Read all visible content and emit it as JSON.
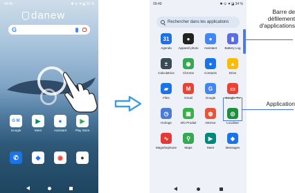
{
  "left_phone": {
    "time": "09:46",
    "status_icons": "✱ ⊙ ▼◪ 35 %",
    "brand": "danew",
    "dock_apps": [
      {
        "label": "Google",
        "icon": "google-folder-icon",
        "color": "#ffffff"
      },
      {
        "label": "Meet",
        "icon": "meet-icon",
        "color": "#ffffff"
      },
      {
        "label": "Assistant",
        "icon": "assistant-icon",
        "color": "#ffffff"
      },
      {
        "label": "Play Store",
        "icon": "play-store-icon",
        "color": "#ffffff"
      }
    ],
    "bottom_dock": [
      {
        "icon": "phone-icon",
        "color": "#1a73e8"
      },
      {
        "icon": "messages-icon",
        "color": "#1a73e8"
      },
      {
        "icon": "chrome-icon",
        "color": "#ffffff"
      },
      {
        "icon": "camera-icon",
        "color": "#ffffff"
      }
    ]
  },
  "right_phone": {
    "time": "09:49",
    "status_icons": "✱ ⊙ ▼◪ 34 %",
    "search_placeholder": "Rechercher dans les applications",
    "apps": [
      {
        "label": "Agenda",
        "icon": "calendar-icon",
        "color": "#1a73e8",
        "glyph": "31"
      },
      {
        "label": "Appareil photo",
        "icon": "camera-icon",
        "color": "#222222",
        "glyph": "●"
      },
      {
        "label": "Assistant",
        "icon": "assistant-icon",
        "color": "#4285f4",
        "glyph": "●"
      },
      {
        "label": "Battery Log",
        "icon": "battery-log-icon",
        "color": "#5b6ee1",
        "glyph": "▮"
      },
      {
        "label": "Calculatrice",
        "icon": "calculator-icon",
        "color": "#3b4a54",
        "glyph": "±"
      },
      {
        "label": "Chrome",
        "icon": "chrome-icon",
        "color": "#34a853",
        "glyph": "◉"
      },
      {
        "label": "Contacts",
        "icon": "contacts-icon",
        "color": "#1a73e8",
        "glyph": "●"
      },
      {
        "label": "Drive",
        "icon": "drive-icon",
        "color": "#fbbc04",
        "glyph": "▲"
      },
      {
        "label": "Files",
        "icon": "files-icon",
        "color": "#1a73e8",
        "glyph": "▰"
      },
      {
        "label": "Gmail",
        "icon": "gmail-icon",
        "color": "#ea4335",
        "glyph": "M"
      },
      {
        "label": "Google",
        "icon": "google-icon",
        "color": "#4285f4",
        "glyph": "G"
      },
      {
        "label": "Google TV",
        "icon": "google-tv-icon",
        "color": "#ea4335",
        "glyph": "▭"
      },
      {
        "label": "Horloge",
        "icon": "clock-icon",
        "color": "#4a7bd8",
        "glyph": "◷"
      },
      {
        "label": "Info Produit",
        "icon": "product-info-icon",
        "color": "#3ab04a",
        "glyph": "▣"
      },
      {
        "label": "Intersor",
        "icon": "intersor-icon",
        "color": "#e6543a",
        "glyph": "◍"
      },
      {
        "label": "Localiser",
        "icon": "find-device-icon",
        "color": "#1e8e3e",
        "glyph": "◎"
      },
      {
        "label": "Magnétophone",
        "icon": "recorder-icon",
        "color": "#e53935",
        "glyph": "∿"
      },
      {
        "label": "Maps",
        "icon": "maps-icon",
        "color": "#34a853",
        "glyph": "⚲"
      },
      {
        "label": "Meet",
        "icon": "meet-icon",
        "color": "#00897b",
        "glyph": "▶"
      },
      {
        "label": "Messages",
        "icon": "messages-icon",
        "color": "#1a73e8",
        "glyph": "◆"
      }
    ]
  },
  "callouts": {
    "scrollbar_label": "Barre de défilement d'applications",
    "application_label": "Application"
  },
  "colors": {
    "accent": "#3d6fd6",
    "arrow": "#3b9ce0"
  }
}
